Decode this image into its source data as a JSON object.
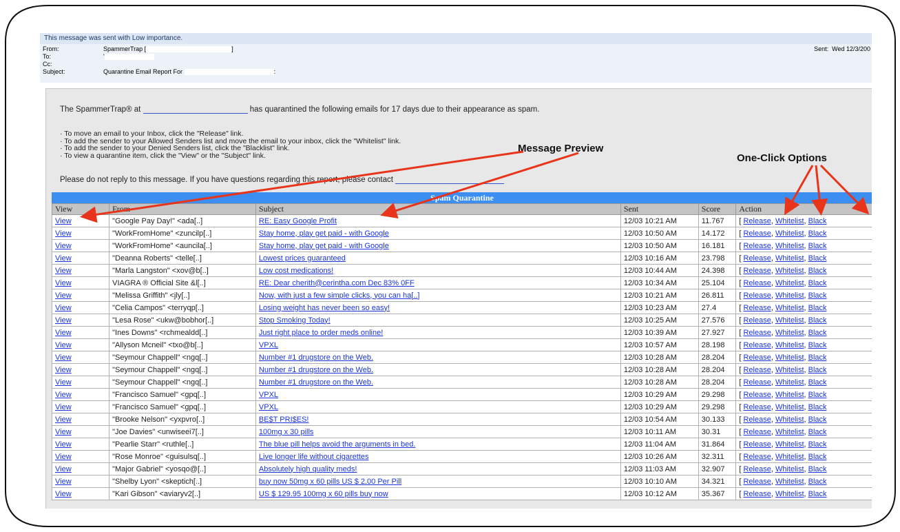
{
  "email": {
    "importance_banner": "This message was sent with Low importance.",
    "from_label": "From:",
    "from_value": "SpammerTrap [",
    "from_suffix": "]",
    "to_label": "To:",
    "cc_label": "Cc:",
    "subject_label": "Subject:",
    "subject_value": "Quarantine Email Report For",
    "subject_suffix": ":",
    "sent_label": "Sent:",
    "sent_value": "Wed 12/3/200"
  },
  "report": {
    "intro_prefix": "The SpammerTrap® at",
    "intro_suffix": "has quarantined the following emails for 17 days due to their appearance as spam.",
    "steps": [
      "· To move an email to your Inbox, click the \"Release\" link.",
      "· To add the sender to your Allowed Senders list and move the email to your inbox, click the \"Whitelist\" link.",
      "· To add the sender to your Denied Senders list, click the \"Blacklist\" link.",
      "· To view a quarantine item, click the \"View\" or the \"Subject\" link."
    ],
    "noreply": "Please do not reply to this message. If you have questions regarding this report, please contact"
  },
  "quarantine": {
    "title": "Spam Quarantine",
    "columns": [
      "View",
      "From",
      "Subject",
      "Sent",
      "Score",
      "Action"
    ],
    "action_labels": {
      "open": "[",
      "release": "Release",
      "sep": ",",
      "whitelist": "Whitelist",
      "blacklist": "Black"
    },
    "rows": [
      {
        "view": "View",
        "from": "\"Google Pay Day!\" <ada[..]",
        "subject": "RE: Easy Google Profit",
        "sent": "12/03 10:21 AM",
        "score": "11.767"
      },
      {
        "view": "View",
        "from": "\"WorkFromHome\" <zuncilp[..]",
        "subject": "Stay home, play get paid - with Google",
        "sent": "12/03 10:50 AM",
        "score": "14.172"
      },
      {
        "view": "View",
        "from": "\"WorkFromHome\" <auncila[..]",
        "subject": "Stay home, play get paid - with Google",
        "sent": "12/03 10:50 AM",
        "score": "16.181"
      },
      {
        "view": "View",
        "from": "\"Deanna Roberts\" <telle[..]",
        "subject": "Lowest prices guaranteed",
        "sent": "12/03 10:16 AM",
        "score": "23.798"
      },
      {
        "view": "View",
        "from": "\"Marla Langston\" <xov@b[..]",
        "subject": "Low cost medications!",
        "sent": "12/03 10:44 AM",
        "score": "24.398"
      },
      {
        "view": "View",
        "from": "VIAGRA ® Official Site &l[..]",
        "subject": "RE: Dear cherith@cerintha.com Dec 83% 0FF",
        "sent": "12/03 10:34 AM",
        "score": "25.104"
      },
      {
        "view": "View",
        "from": "\"Melissa Griffith\" <jly[..]",
        "subject": "Now, with just a few simple clicks, you can ha[..]",
        "sent": "12/03 10:21 AM",
        "score": "26.811"
      },
      {
        "view": "View",
        "from": "\"Celia Campos\" <terryqp[..]",
        "subject": "Losing weight has never been so easy!",
        "sent": "12/03 10:23 AM",
        "score": "27.4"
      },
      {
        "view": "View",
        "from": "\"Lesa Rose\" <ukw@bobhor[..]",
        "subject": "Stop Smoking Today!",
        "sent": "12/03 10:25 AM",
        "score": "27.576"
      },
      {
        "view": "View",
        "from": "\"Ines Downs\" <rchmealdd[..]",
        "subject": "Just right place to order meds online!",
        "sent": "12/03 10:39 AM",
        "score": "27.927"
      },
      {
        "view": "View",
        "from": "\"Allyson Mcneil\" <txo@b[..]",
        "subject": "VPXL",
        "sent": "12/03 10:57 AM",
        "score": "28.198"
      },
      {
        "view": "View",
        "from": "\"Seymour Chappell\" <ngq[..]",
        "subject": "Number #1 drugstore on the Web.",
        "sent": "12/03 10:28 AM",
        "score": "28.204"
      },
      {
        "view": "View",
        "from": "\"Seymour Chappell\" <ngq[..]",
        "subject": "Number #1 drugstore on the Web.",
        "sent": "12/03 10:28 AM",
        "score": "28.204"
      },
      {
        "view": "View",
        "from": "\"Seymour Chappell\" <ngq[..]",
        "subject": "Number #1 drugstore on the Web.",
        "sent": "12/03 10:28 AM",
        "score": "28.204"
      },
      {
        "view": "View",
        "from": "\"Francisco Samuel\" <gpq[..]",
        "subject": "VPXL",
        "sent": "12/03 10:29 AM",
        "score": "29.298"
      },
      {
        "view": "View",
        "from": "\"Francisco Samuel\" <gpq[..]",
        "subject": "VPXL",
        "sent": "12/03 10:29 AM",
        "score": "29.298"
      },
      {
        "view": "View",
        "from": "\"Brooke Nelson\" <yxpvro[..]",
        "subject": "BE$T PRI$ES!",
        "sent": "12/03 10:54 AM",
        "score": "30.133"
      },
      {
        "view": "View",
        "from": "\"Joe Davies\" <unwiseei7[..]",
        "subject": "100mg x 30 pills",
        "sent": "12/03 10:11 AM",
        "score": "30.31"
      },
      {
        "view": "View",
        "from": "\"Pearlie Starr\" <ruthle[..]",
        "subject": "The blue pill helps avoid the arguments in bed.",
        "sent": "12/03 11:04 AM",
        "score": "31.864"
      },
      {
        "view": "View",
        "from": "\"Rose Monroe\" <guisulsq[..]",
        "subject": "Live longer life without cigarettes",
        "sent": "12/03 10:26 AM",
        "score": "32.311"
      },
      {
        "view": "View",
        "from": "\"Major Gabriel\" <yosqo@[..]",
        "subject": "Absolutely high quality meds!",
        "sent": "12/03 11:03 AM",
        "score": "32.907"
      },
      {
        "view": "View",
        "from": "\"Shelby Lyon\" <skeptich[..]",
        "subject": "buy now 50mg x 60 pills US $ 2.00 Per Pill",
        "sent": "12/03 10:10 AM",
        "score": "34.321"
      },
      {
        "view": "View",
        "from": "\"Kari Gibson\" <aviaryv2[..]",
        "subject": "US $ 129.95 100mg x 60 pills buy now",
        "sent": "12/03 10:12 AM",
        "score": "35.367"
      }
    ]
  },
  "annotations": {
    "message_preview": "Message Preview",
    "one_click_options": "One-Click Options"
  },
  "colors": {
    "link": "#1a34d8",
    "table_header": "#3c8ff0",
    "arrow": "#e8341a",
    "banner": "#dce6f4"
  }
}
